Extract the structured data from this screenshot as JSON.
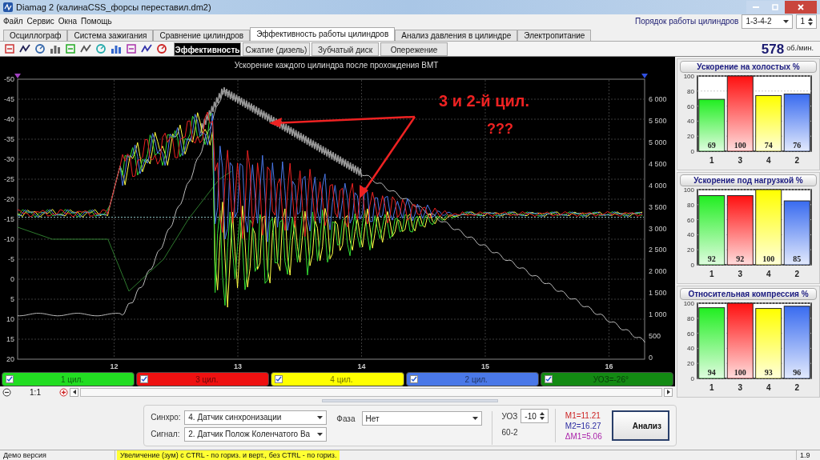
{
  "window": {
    "title": "Diamag 2 (калинаCSS_форсы переставил.dm2)"
  },
  "menu": [
    "Файл",
    "Сервис",
    "Окна",
    "Помощь"
  ],
  "cylinder_order": {
    "label": "Порядок работы цилиндров",
    "value": "1-3-4-2",
    "spinner": "1"
  },
  "tabs": [
    {
      "label": "Осциллограф",
      "selected": false
    },
    {
      "label": "Система зажигания",
      "selected": false
    },
    {
      "label": "Сравнение цилиндров",
      "selected": false
    },
    {
      "label": "Эффективность работы цилиндров",
      "selected": true
    },
    {
      "label": "Анализ давления в цилиндре",
      "selected": false
    },
    {
      "label": "Электропитание",
      "selected": false
    }
  ],
  "subtabs": [
    {
      "label": "Эффективность",
      "selected": true
    },
    {
      "label": "Сжатие (дизель)",
      "selected": false
    },
    {
      "label": "Зубчатый диск",
      "selected": false
    },
    {
      "label": "Опережение",
      "selected": false
    }
  ],
  "rpm": {
    "value": "578",
    "unit": "об./мин."
  },
  "chart": {
    "title": "Ускорение каждого цилиндра после прохождения ВМТ",
    "y_left_ticks": [
      "-50",
      "-45",
      "-40",
      "-35",
      "-30",
      "-25",
      "-20",
      "-15",
      "-10",
      "-5",
      "0",
      "5",
      "10",
      "15",
      "20"
    ],
    "y_right_ticks": [
      "6 000",
      "5 500",
      "5 000",
      "4 500",
      "4 000",
      "3 500",
      "3 000",
      "2 500",
      "2 000",
      "1 500",
      "1 000",
      "500",
      "0"
    ],
    "x_ticks": [
      "12",
      "13",
      "14",
      "15",
      "16"
    ],
    "annotation": [
      "3 и 2-й цил.",
      "???"
    ]
  },
  "legend": [
    {
      "label": "1 цил.",
      "color": "#22dd22",
      "checked": true
    },
    {
      "label": "3 цил.",
      "color": "#ee1111",
      "checked": true
    },
    {
      "label": "4 цил.",
      "color": "#ffff00",
      "checked": true
    },
    {
      "label": "2 цил.",
      "color": "#4a78e8",
      "checked": true
    },
    {
      "label": "УОЗ=-26°",
      "color": "#138a13",
      "checked": true
    }
  ],
  "zoom": {
    "label": "1:1"
  },
  "sync": {
    "label": "Синхро:",
    "value": "4. Датчик синхронизации"
  },
  "signal": {
    "label": "Сигнал:",
    "value": "2. Датчик Полож Коленчатого Ва"
  },
  "phase": {
    "label": "Фаза",
    "value": "Нет"
  },
  "uoz": {
    "label": "УОЗ",
    "value": "-10",
    "note": "60-2"
  },
  "markers": [
    {
      "text": "M1=11.21",
      "color": "#cc2222"
    },
    {
      "text": "M2=16.27",
      "color": "#2a2aa0"
    },
    {
      "text": "ΔM1=5.06",
      "color": "#aa22aa"
    }
  ],
  "analyze_button": "Анализ",
  "bar_charts": [
    {
      "title": "Ускорение на холостых %",
      "chart_data": {
        "type": "bar",
        "categories": [
          "1",
          "3",
          "4",
          "2"
        ],
        "values": [
          69,
          100,
          74,
          76
        ],
        "colors": [
          "#22ee22",
          "#ff1111",
          "#ffff00",
          "#3a6cf0"
        ],
        "grid": true,
        "ylim": [
          0,
          100
        ],
        "yticks": [
          0,
          20,
          40,
          60,
          80,
          100
        ],
        "data_labels": true
      }
    },
    {
      "title": "Ускорение под нагрузкой %",
      "chart_data": {
        "type": "bar",
        "categories": [
          "1",
          "3",
          "4",
          "2"
        ],
        "values": [
          92,
          92,
          100,
          85
        ],
        "colors": [
          "#22ee22",
          "#ff1111",
          "#ffff00",
          "#3a6cf0"
        ],
        "grid": true,
        "ylim": [
          0,
          100
        ],
        "yticks": [
          0,
          20,
          40,
          60,
          80,
          100
        ],
        "data_labels": true
      }
    },
    {
      "title": "Относительная компрессия %",
      "chart_data": {
        "type": "bar",
        "categories": [
          "1",
          "3",
          "4",
          "2"
        ],
        "values": [
          94,
          100,
          93,
          96
        ],
        "colors": [
          "#22ee22",
          "#ff1111",
          "#ffff00",
          "#3a6cf0"
        ],
        "grid": true,
        "ylim": [
          0,
          100
        ],
        "yticks": [
          0,
          20,
          40,
          60,
          80,
          100
        ],
        "data_labels": true
      }
    }
  ],
  "status_bar": {
    "left": "Демо версия",
    "hint": "Увеличение (зум) с CTRL - по гориз. и верт., без CTRL - по гориз.",
    "version": "1.9"
  }
}
